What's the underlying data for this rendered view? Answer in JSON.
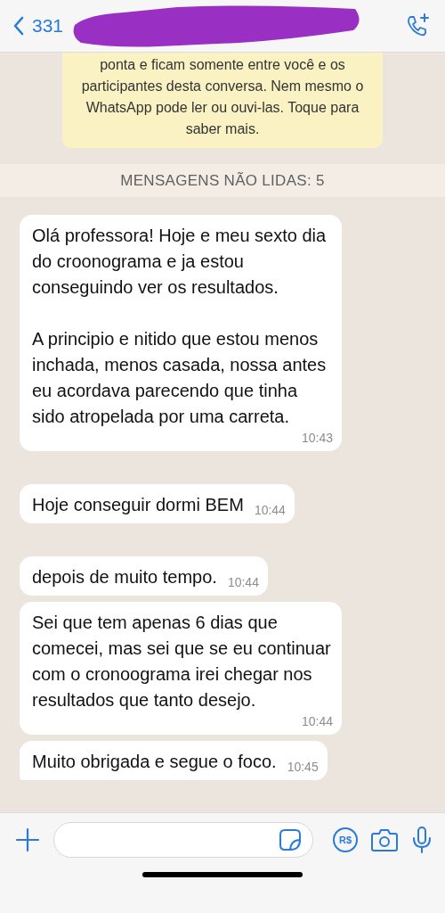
{
  "header": {
    "back_label": "331",
    "name_redacted": true
  },
  "encryption_notice": {
    "text": "ponta e ficam somente entre você e os participantes desta conversa. Nem mesmo o WhatsApp pode ler ou ouvi-las. Toque para saber mais."
  },
  "unread_banner": {
    "text": "MENSAGENS NÃO LIDAS: 5"
  },
  "messages": [
    {
      "text": "Olá professora! Hoje e meu sexto dia do croonograma e ja estou conseguindo ver os resultados.\n\nA principio e nitido que estou menos inchada, menos casada, nossa antes eu acordava parecendo que tinha sido atropelada por uma carreta.",
      "time": "10:43",
      "tail": false
    },
    {
      "text": "Hoje conseguir dormi BEM",
      "time": "10:44",
      "tail": false
    },
    {
      "text": "depois de muito tempo.",
      "time": "10:44",
      "tail": false
    },
    {
      "text": "Sei que tem apenas 6 dias que comecei, mas sei que se eu continuar com o cronoograma irei chegar nos resultados que tanto desejo.",
      "time": "10:44",
      "tail": false
    },
    {
      "text": "Muito obrigada e segue o foco.",
      "time": "10:45",
      "tail": true
    }
  ],
  "composer": {
    "payment_label": "R$"
  }
}
